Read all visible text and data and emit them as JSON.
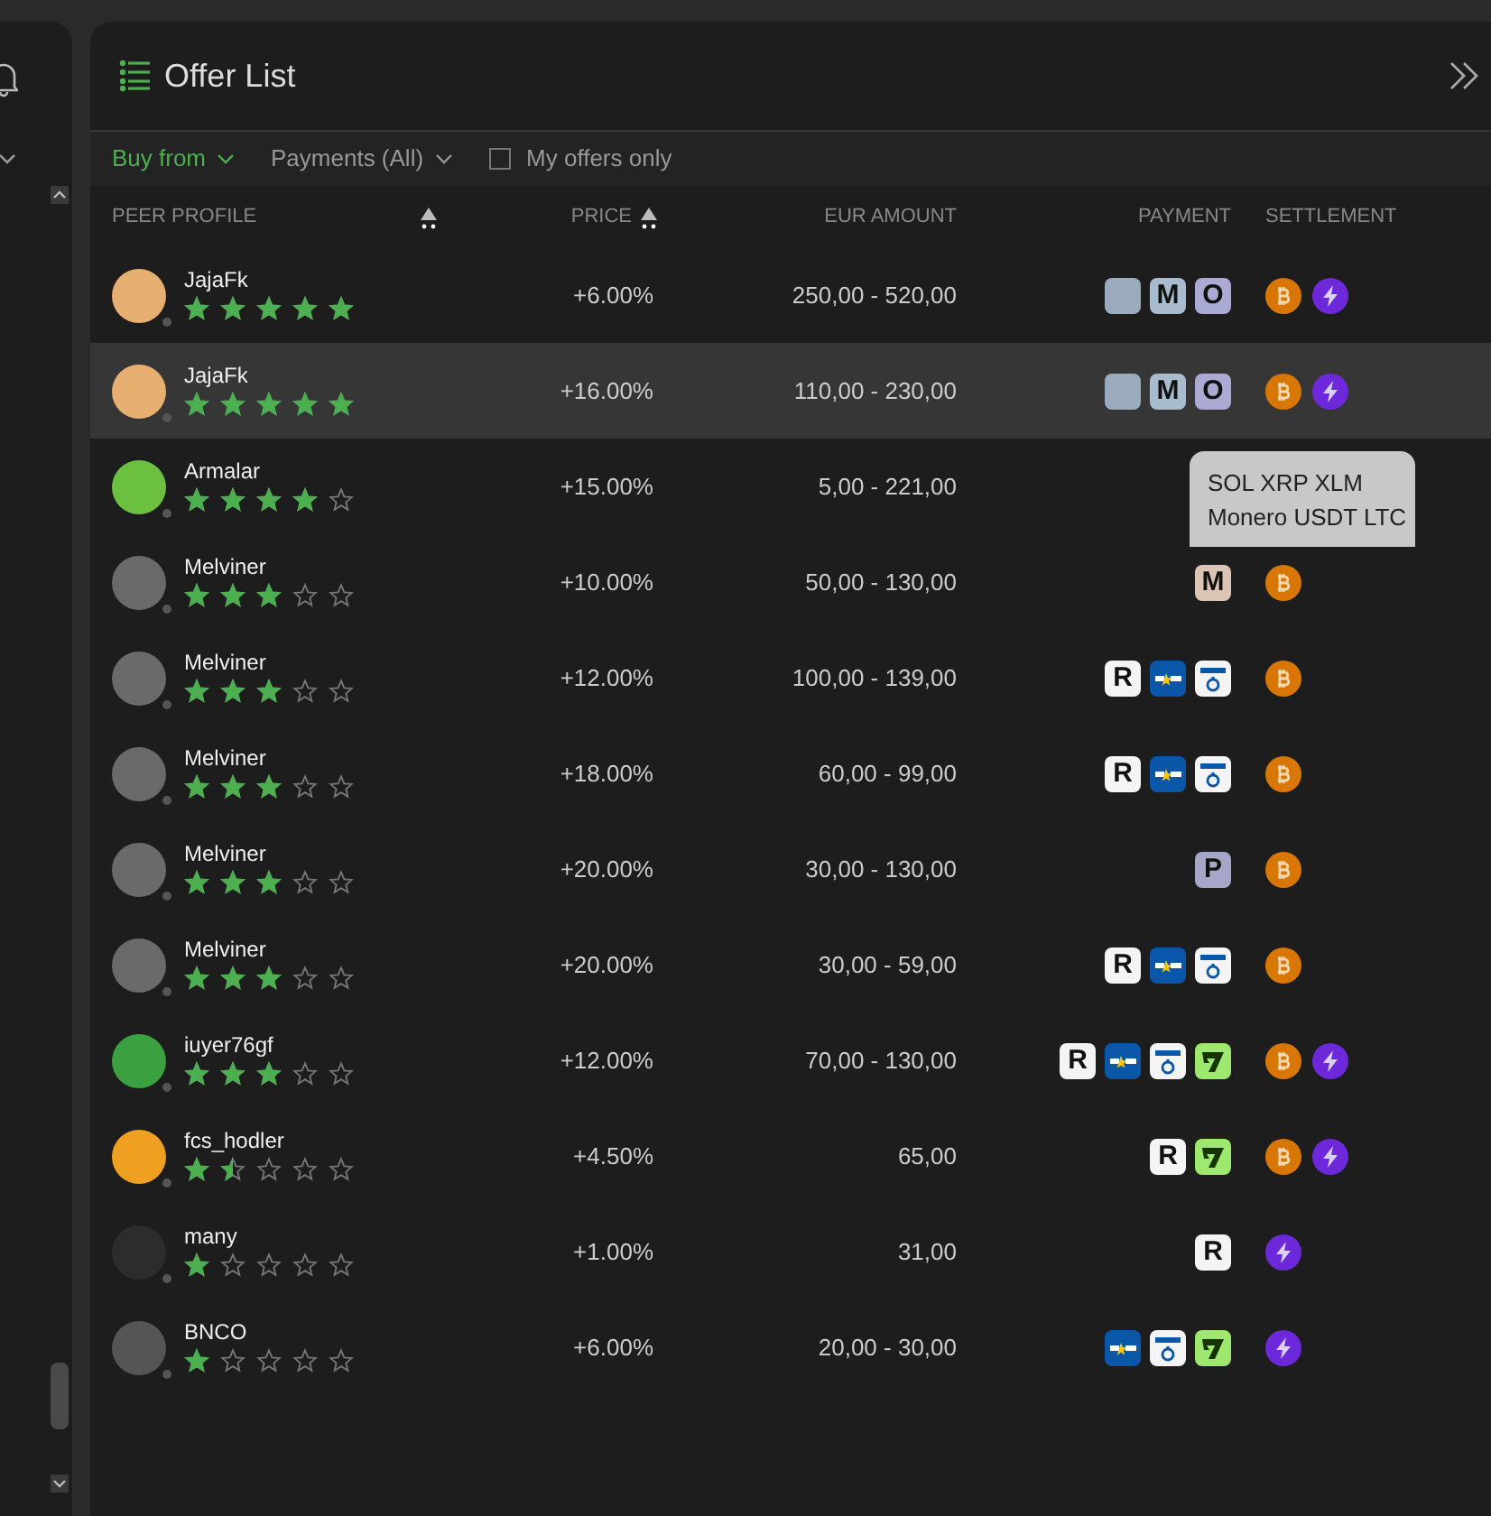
{
  "header": {
    "title": "Offer List"
  },
  "filters": {
    "side": {
      "label": "Buy from"
    },
    "payments": {
      "label": "Payments (All)"
    },
    "my_offers": {
      "label": "My offers only",
      "checked": false
    }
  },
  "columns": [
    {
      "label": "PEER PROFILE",
      "sortable": true
    },
    {
      "label": "PRICE",
      "sortable": true
    },
    {
      "label": "EUR AMOUNT",
      "sortable": false
    },
    {
      "label": "PAYMENT",
      "sortable": false
    },
    {
      "label": "SETTLEMENT",
      "sortable": false
    }
  ],
  "rows": [
    {
      "name": "JajaFk",
      "stars": 5,
      "price": "+6.00%",
      "amount": "250,00 - 520,00",
      "selected": false,
      "color": "#e8b070",
      "payments": [
        {
          "kind": "plain",
          "color": "#9aabbd"
        },
        {
          "kind": "letter",
          "letter": "M",
          "color": "#a9bccd"
        },
        {
          "kind": "letter",
          "letter": "O",
          "color": "#aaaad2"
        }
      ],
      "settlement": [
        {
          "kind": "btc"
        },
        {
          "kind": "lightning"
        }
      ]
    },
    {
      "name": "JajaFk",
      "stars": 5,
      "price": "+16.00%",
      "amount": "110,00 - 230,00",
      "selected": true,
      "color": "#e8b070",
      "payments": [
        {
          "kind": "plain",
          "color": "#9aabbd"
        },
        {
          "kind": "letter",
          "letter": "M",
          "color": "#a9bccd"
        },
        {
          "kind": "letter",
          "letter": "O",
          "color": "#aaaad2"
        }
      ],
      "settlement": [
        {
          "kind": "btc"
        },
        {
          "kind": "lightning"
        }
      ]
    },
    {
      "name": "Armalar",
      "stars": 4,
      "price": "+15.00%",
      "amount": "5,00 - 221,00",
      "selected": false,
      "color": "#6cc040",
      "payments": [],
      "settlement": []
    },
    {
      "name": "Melviner",
      "stars": 3,
      "price": "+10.00%",
      "amount": "50,00 - 130,00",
      "selected": false,
      "color": "#6a6a6a",
      "payments": [
        {
          "kind": "letter",
          "letter": "M",
          "color": "#dcc4b4"
        }
      ],
      "settlement": [
        {
          "kind": "btc"
        }
      ]
    },
    {
      "name": "Melviner",
      "stars": 3,
      "price": "+12.00%",
      "amount": "100,00 - 139,00",
      "selected": false,
      "color": "#6a6a6a",
      "payments": [
        {
          "kind": "letter",
          "letter": "R",
          "color": "#f4f4f4"
        },
        {
          "kind": "sepa"
        },
        {
          "kind": "sepa_instant"
        }
      ],
      "settlement": [
        {
          "kind": "btc"
        }
      ]
    },
    {
      "name": "Melviner",
      "stars": 3,
      "price": "+18.00%",
      "amount": "60,00 - 99,00",
      "selected": false,
      "color": "#6a6a6a",
      "payments": [
        {
          "kind": "letter",
          "letter": "R",
          "color": "#f4f4f4"
        },
        {
          "kind": "sepa"
        },
        {
          "kind": "sepa_instant"
        }
      ],
      "settlement": [
        {
          "kind": "btc"
        }
      ]
    },
    {
      "name": "Melviner",
      "stars": 3,
      "price": "+20.00%",
      "amount": "30,00 - 130,00",
      "selected": false,
      "color": "#6a6a6a",
      "payments": [
        {
          "kind": "letter",
          "letter": "P",
          "color": "#a6a6c9"
        }
      ],
      "settlement": [
        {
          "kind": "btc"
        }
      ]
    },
    {
      "name": "Melviner",
      "stars": 3,
      "price": "+20.00%",
      "amount": "30,00 - 59,00",
      "selected": false,
      "color": "#6a6a6a",
      "payments": [
        {
          "kind": "letter",
          "letter": "R",
          "color": "#f4f4f4"
        },
        {
          "kind": "sepa"
        },
        {
          "kind": "sepa_instant"
        }
      ],
      "settlement": [
        {
          "kind": "btc"
        }
      ]
    },
    {
      "name": "iuyer76gf",
      "stars": 3,
      "price": "+12.00%",
      "amount": "70,00 - 130,00",
      "selected": false,
      "color": "#3aa040",
      "payments": [
        {
          "kind": "letter",
          "letter": "R",
          "color": "#f4f4f4"
        },
        {
          "kind": "sepa"
        },
        {
          "kind": "sepa_instant"
        },
        {
          "kind": "wise"
        }
      ],
      "settlement": [
        {
          "kind": "btc"
        },
        {
          "kind": "lightning"
        }
      ]
    },
    {
      "name": "fcs_hodler",
      "stars": 1.5,
      "price": "+4.50%",
      "amount": "65,00",
      "selected": false,
      "color": "#f0a020",
      "payments": [
        {
          "kind": "letter",
          "letter": "R",
          "color": "#f4f4f4"
        },
        {
          "kind": "wise"
        }
      ],
      "settlement": [
        {
          "kind": "btc"
        },
        {
          "kind": "lightning"
        }
      ]
    },
    {
      "name": "many",
      "stars": 1,
      "price": "+1.00%",
      "amount": "31,00",
      "selected": false,
      "color": "#2c2c2c",
      "payments": [
        {
          "kind": "letter",
          "letter": "R",
          "color": "#f4f4f4"
        }
      ],
      "settlement": [
        {
          "kind": "lightning"
        }
      ]
    },
    {
      "name": "BNCO",
      "stars": 1,
      "price": "+6.00%",
      "amount": "20,00 - 30,00",
      "selected": false,
      "color": "#555555",
      "payments": [
        {
          "kind": "sepa"
        },
        {
          "kind": "sepa_instant"
        },
        {
          "kind": "wise"
        }
      ],
      "settlement": [
        {
          "kind": "lightning"
        }
      ]
    }
  ],
  "tooltip": {
    "lines": [
      "SOL XRP XLM",
      "Monero USDT LTC"
    ]
  }
}
